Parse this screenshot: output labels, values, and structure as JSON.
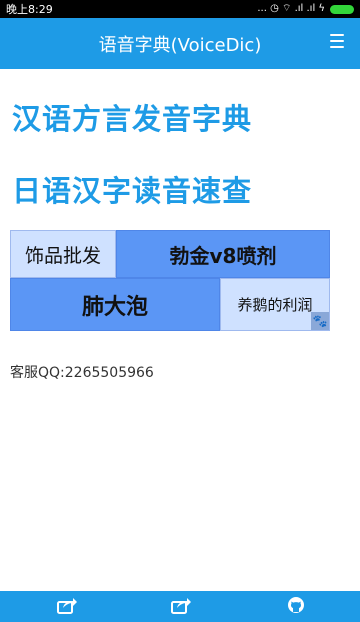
{
  "status_bar": {
    "time": "晚上8:29",
    "indicators": "... ◷ ⌔ .ıl .ıl ϟ"
  },
  "app_bar": {
    "title": "语音字典(VoiceDic)",
    "menu_icon": "hamburger-menu-icon"
  },
  "links": [
    {
      "label": "汉语方言发音字典"
    },
    {
      "label": "日语汉字读音速查"
    }
  ],
  "ads": [
    {
      "label": "饰品批发"
    },
    {
      "label": "勃金v8喷剂"
    },
    {
      "label": "肺大泡"
    },
    {
      "label": "养鹅的利润"
    }
  ],
  "ad_badge_icon": "paw-icon",
  "contact": {
    "text": "客服QQ:2265505966"
  },
  "bottom_bar": {
    "icons": [
      "share-icon",
      "share-icon",
      "github-icon"
    ]
  },
  "colors": {
    "primary": "#1e9be6",
    "ad_dark": "#5b96f5",
    "ad_light": "#cfe1ff"
  }
}
